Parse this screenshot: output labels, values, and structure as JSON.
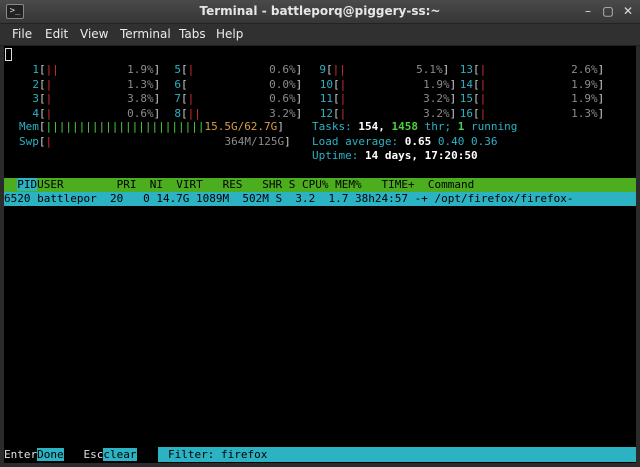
{
  "window": {
    "title": "Terminal - battleporq@piggery-ss:~",
    "icon": "terminal-icon"
  },
  "menu": [
    "File",
    "Edit",
    "View",
    "Terminal",
    "Tabs",
    "Help"
  ],
  "cpus": [
    {
      "n": "1",
      "bar": "||",
      "pct": "1.9%"
    },
    {
      "n": "2",
      "bar": "|",
      "pct": "1.3%"
    },
    {
      "n": "3",
      "bar": "|",
      "pct": "3.8%"
    },
    {
      "n": "4",
      "bar": "|",
      "pct": "0.6%"
    },
    {
      "n": "5",
      "bar": "|",
      "pct": "0.6%"
    },
    {
      "n": "6",
      "bar": "",
      "pct": "0.0%"
    },
    {
      "n": "7",
      "bar": "|",
      "pct": "0.6%"
    },
    {
      "n": "8",
      "bar": "||",
      "pct": "3.2%"
    },
    {
      "n": "9",
      "bar": "||",
      "pct": "5.1%"
    },
    {
      "n": "10",
      "bar": "|",
      "pct": "1.9%"
    },
    {
      "n": "11",
      "bar": "|",
      "pct": "3.2%"
    },
    {
      "n": "12",
      "bar": "|",
      "pct": "3.2%"
    },
    {
      "n": "13",
      "bar": "|",
      "pct": "2.6%"
    },
    {
      "n": "14",
      "bar": "|",
      "pct": "1.9%"
    },
    {
      "n": "15",
      "bar": "|",
      "pct": "1.9%"
    },
    {
      "n": "16",
      "bar": "|",
      "pct": "1.3%"
    }
  ],
  "mem": {
    "label": "Mem",
    "bar": "||||||||||||||||||||||||",
    "value": "15.5G/62.7G"
  },
  "swp": {
    "label": "Swp",
    "bar": "|",
    "value": "364M/125G"
  },
  "tasks": {
    "label": "Tasks:",
    "count": "154,",
    "thr": "1458",
    "thr_label": "thr;",
    "running": "1",
    "running_label": "running"
  },
  "load": {
    "label": "Load average:",
    "v1": "0.65",
    "v2": "0.40",
    "v3": "0.36"
  },
  "uptime": {
    "label": "Uptime:",
    "value": "14 days, 17:20:50"
  },
  "columns": {
    "pid": "PID",
    "user": "USER",
    "rest": "        PRI  NI  VIRT   RES   SHR S CPU% MEM%   TIME+  Command"
  },
  "process": "6520 battlepor  20   0 14.7G 1089M  502M S  3.2  1.7 38h24:57 -+ /opt/firefox/firefox-",
  "footer": {
    "k1": "Enter",
    "a1": "Done",
    "k2": "Esc",
    "a2": "clear",
    "filter_label": "Filter:",
    "filter_value": "firefox"
  }
}
